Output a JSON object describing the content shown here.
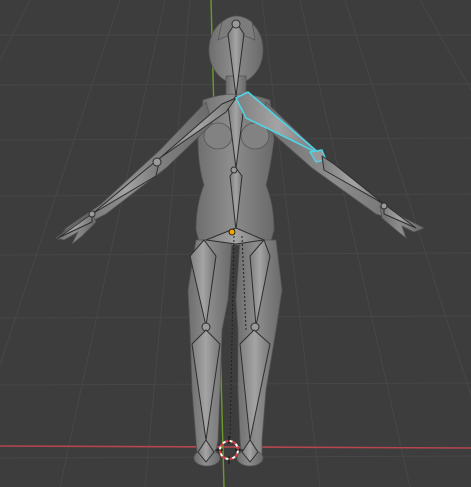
{
  "viewport": {
    "mode": "pose",
    "projection": "front",
    "colors": {
      "background": "#3d3d3d",
      "grid": "#454545",
      "axis_x": "#b5454f",
      "axis_z": "#6c9a2a",
      "bone_fill": "#9a9a9a",
      "bone_stroke": "#2e2e2e",
      "bone_selected": "#4fd3e6",
      "origin": "#f2a500",
      "cursor_red": "#d94040",
      "cursor_white": "#ffffff"
    }
  },
  "scene": {
    "object": "female-base-mesh",
    "armature": "humanoid-armature",
    "selected_bone": "upper-arm-left",
    "bones": [
      "head",
      "neck",
      "spine-upper",
      "spine-lower",
      "hips",
      "shoulder-left",
      "upper-arm-left",
      "forearm-left",
      "hand-left",
      "shoulder-right",
      "upper-arm-right",
      "forearm-right",
      "hand-right",
      "thigh-left",
      "shin-left",
      "foot-left",
      "thigh-right",
      "shin-right",
      "foot-right"
    ]
  },
  "cursor": {
    "icon": "3d-cursor-icon"
  }
}
